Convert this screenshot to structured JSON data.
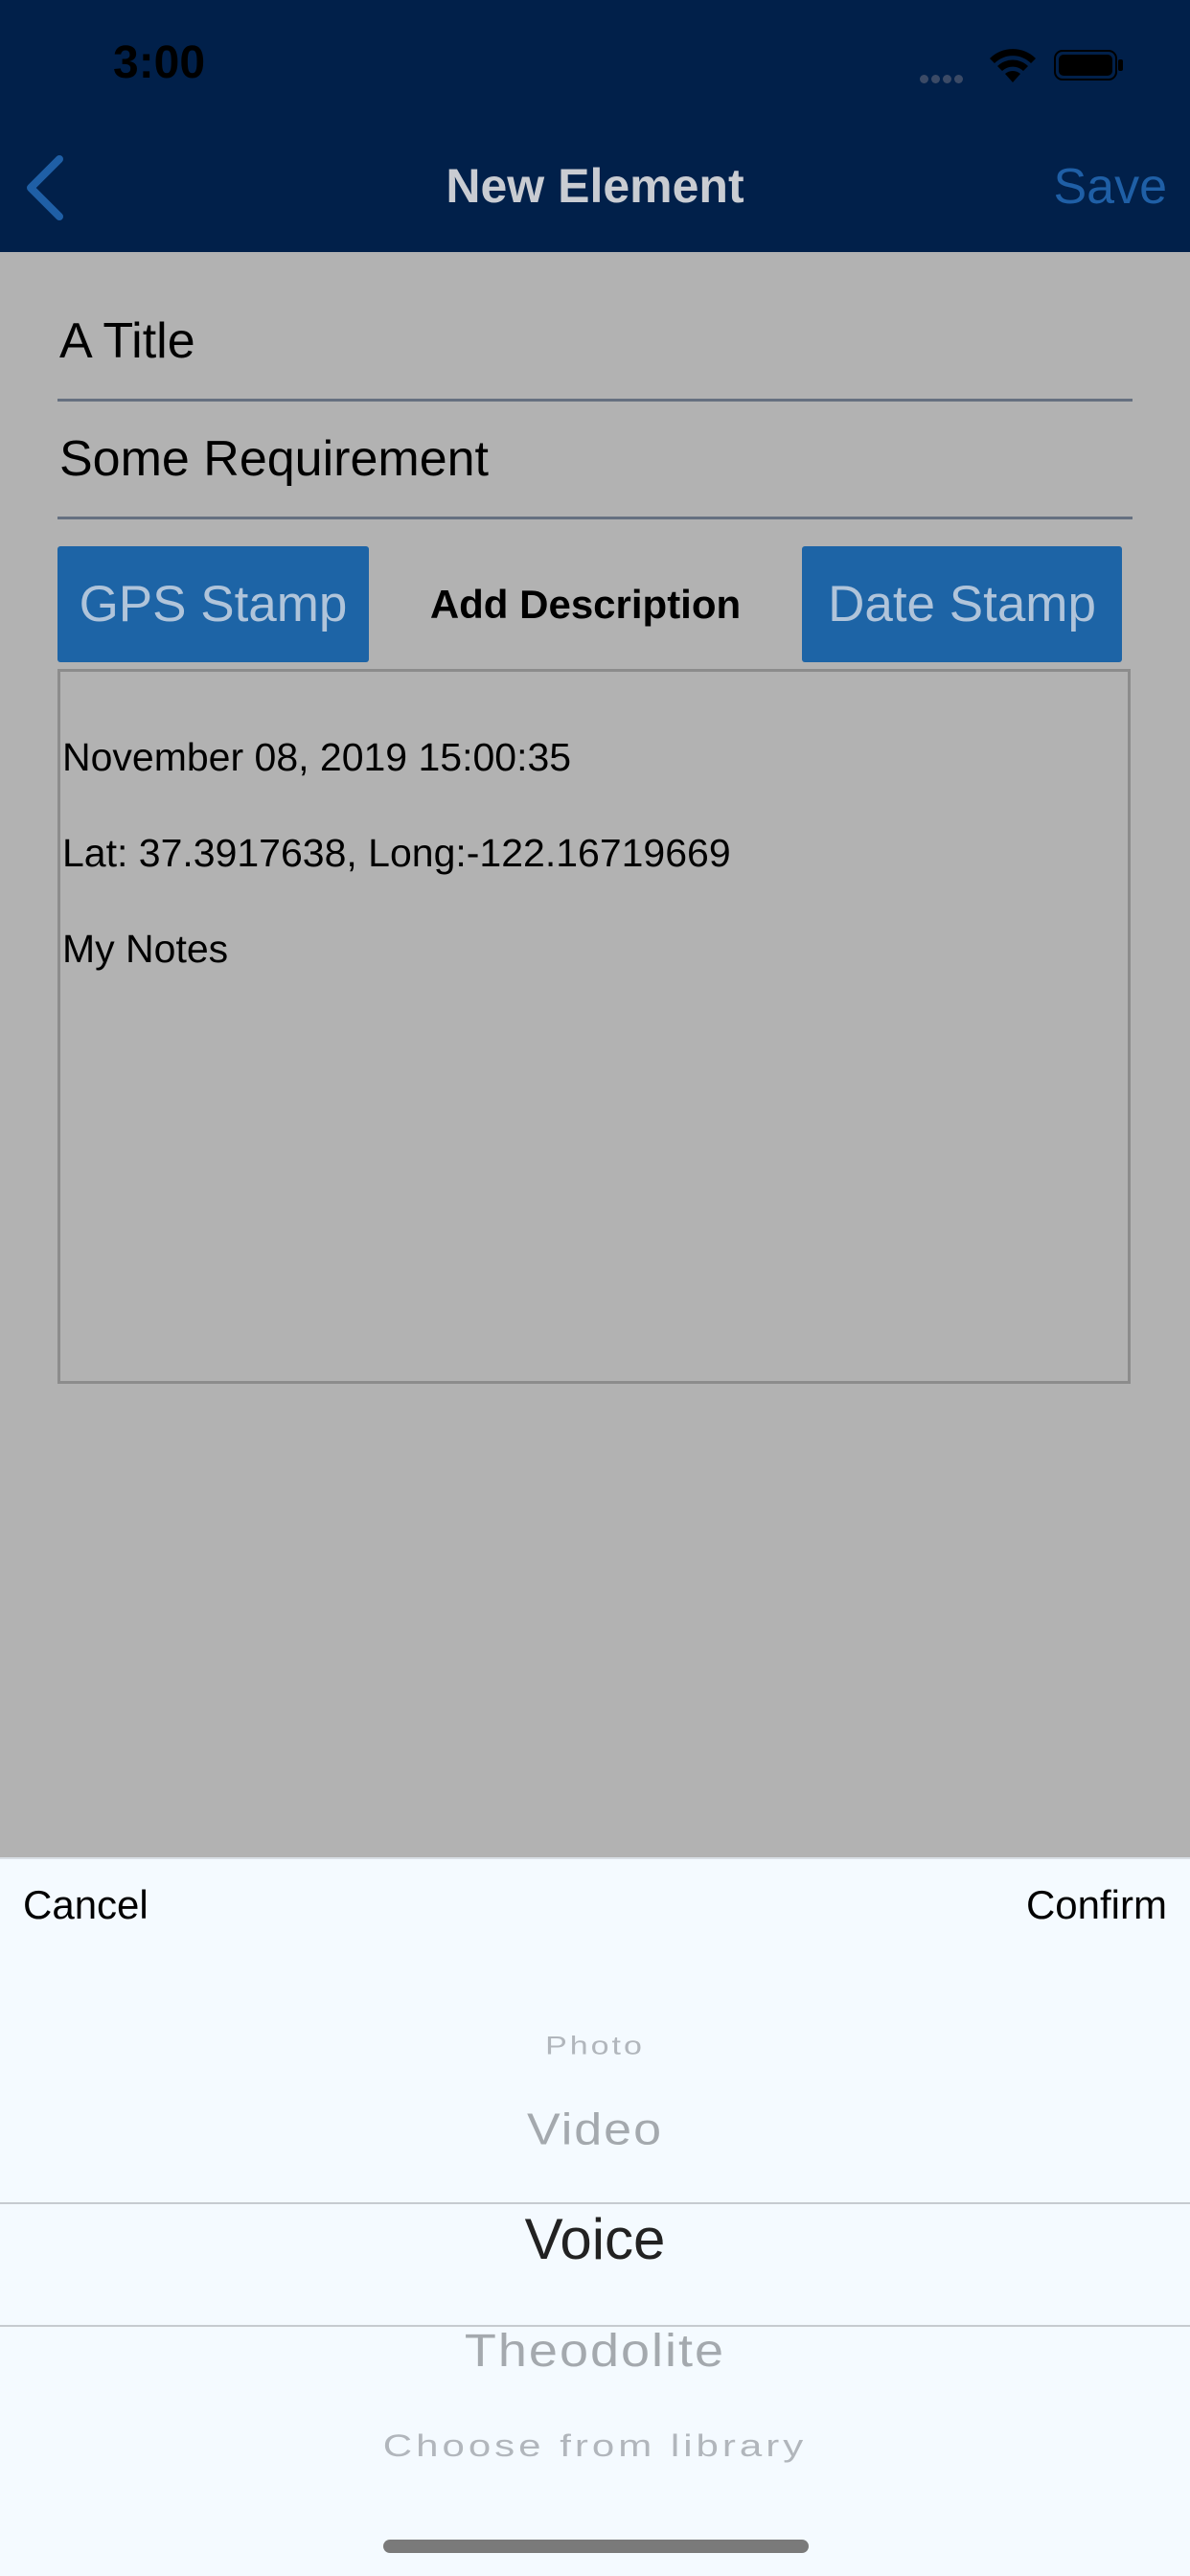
{
  "status_bar": {
    "time": "3:00"
  },
  "nav": {
    "title": "New Element",
    "save_label": "Save",
    "back_icon": "chevron-left-icon"
  },
  "form": {
    "title_value": "A Title",
    "requirement_value": "Some Requirement",
    "gps_stamp_label": "GPS Stamp",
    "add_description_label": "Add Description",
    "date_stamp_label": "Date Stamp",
    "description_lines": [
      "November 08, 2019 15:00:35",
      "Lat: 37.3917638, Long:-122.16719669",
      "My Notes"
    ]
  },
  "picker": {
    "cancel_label": "Cancel",
    "confirm_label": "Confirm",
    "options": [
      "Photo",
      "Video",
      "Voice",
      "Theodolite",
      "Choose from library"
    ],
    "selected": "Voice"
  },
  "colors": {
    "header_bg": "#01204a",
    "accent_blue": "#1d64a6",
    "overlay_gray": "#b2b2b2",
    "sheet_bg": "#f4faff"
  }
}
